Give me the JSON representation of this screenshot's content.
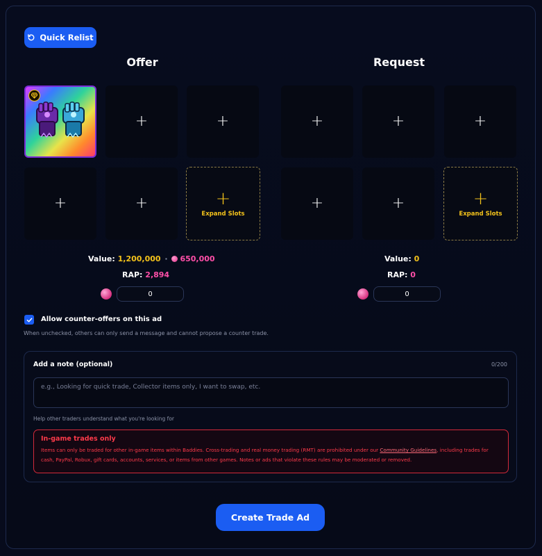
{
  "quick_relist": {
    "label": "Quick Relist",
    "icon": "refresh-icon"
  },
  "offer": {
    "title": "Offer",
    "slots": [
      {
        "type": "item",
        "name": ""
      },
      {
        "type": "empty",
        "symbol": "+"
      },
      {
        "type": "empty",
        "symbol": "+"
      },
      {
        "type": "empty",
        "symbol": "+"
      },
      {
        "type": "empty",
        "symbol": "+"
      },
      {
        "type": "expand",
        "symbol": "+",
        "label": "Expand Slots"
      }
    ],
    "value_label": "Value:",
    "value": "1,200,000",
    "separator": "·",
    "gem_value": "650,000",
    "rap_label": "RAP:",
    "rap": "2,894",
    "coin_input": "0"
  },
  "request": {
    "title": "Request",
    "slots": [
      {
        "type": "empty",
        "symbol": "+"
      },
      {
        "type": "empty",
        "symbol": "+"
      },
      {
        "type": "empty",
        "symbol": "+"
      },
      {
        "type": "empty",
        "symbol": "+"
      },
      {
        "type": "empty",
        "symbol": "+"
      },
      {
        "type": "expand",
        "symbol": "+",
        "label": "Expand Slots"
      }
    ],
    "value_label": "Value:",
    "value": "0",
    "rap_label": "RAP:",
    "rap": "0",
    "coin_input": "0"
  },
  "counter_offers": {
    "checked": true,
    "label": "Allow counter-offers on this ad",
    "hint": "When unchecked, others can only send a message and cannot propose a counter trade."
  },
  "note": {
    "title": "Add a note (optional)",
    "count": "0/200",
    "placeholder": "e.g., Looking for quick trade, Collector items only, I want to swap, etc.",
    "help": "Help other traders understand what you're looking for"
  },
  "warning": {
    "title": "In-game trades only",
    "text_before": "Items can only be traded for other in-game items within Baddies. Cross-trading and real money trading (RMT) are prohibited under our ",
    "link": "Community Guidelines",
    "text_after": ", including trades for cash, PayPal, Robux, gift cards, accounts, services, or items from other games. Notes or ads that violate these rules may be moderated or removed."
  },
  "create_button": {
    "label": "Create Trade Ad"
  },
  "colors": {
    "accent": "#1b5df2",
    "gold": "#f3c21b",
    "pink": "#ff4fa8",
    "danger": "#ff3a4a",
    "background": "#070b1c"
  }
}
